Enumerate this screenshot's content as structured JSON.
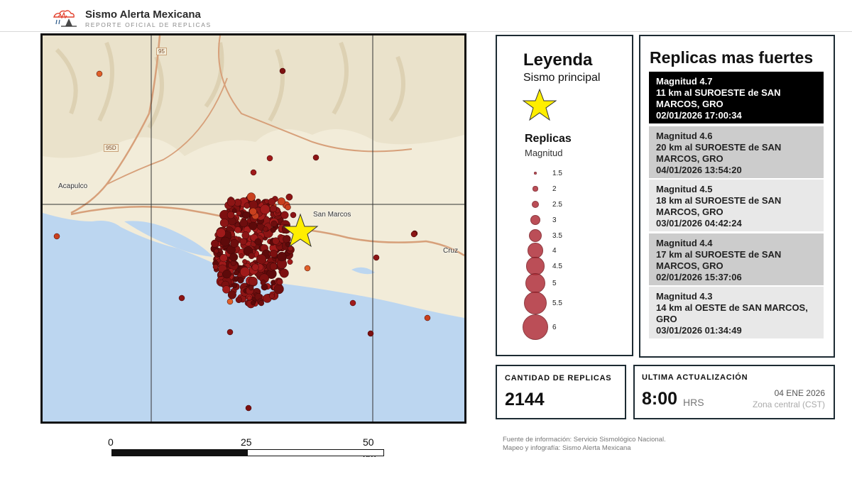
{
  "app": {
    "title": "Sismo Alerta Mexicana",
    "subtitle": "REPORTE OFICIAL DE REPLICAS"
  },
  "map": {
    "places": [
      "Acapulco",
      "San Marcos",
      "Cruz"
    ],
    "roads": [
      "95",
      "95D"
    ],
    "colors": {
      "land": "#f2ecd9",
      "sea": "#bcd6f0",
      "aftershock": "#8a1414",
      "main_shock": "#ffee00"
    }
  },
  "scale_bar": {
    "labels": [
      "0",
      "25",
      "50 km"
    ]
  },
  "legend": {
    "title": "Leyenda",
    "main_shock_label": "Sismo principal",
    "main_shock_icon": "star-icon",
    "aftershocks_label": "Replicas",
    "magnitude_label": "Magnitud",
    "sizes": [
      "1.5",
      "2",
      "2.5",
      "3",
      "3.5",
      "4",
      "4.5",
      "5",
      "5.5",
      "6"
    ]
  },
  "strongest": {
    "title": "Replicas mas fuertes",
    "items": [
      {
        "magnitude": "Magnitud 4.7",
        "location": "11 km al SUROESTE de SAN MARCOS, GRO",
        "datetime": "02/01/2026 17:00:34"
      },
      {
        "magnitude": "Magnitud 4.6",
        "location": "20 km al SUROESTE de SAN MARCOS, GRO",
        "datetime": "04/01/2026 13:54:20"
      },
      {
        "magnitude": "Magnitud 4.5",
        "location": "18 km al SUROESTE de SAN MARCOS, GRO",
        "datetime": "03/01/2026 04:42:24"
      },
      {
        "magnitude": "Magnitud 4.4",
        "location": "17 km al SUROESTE de SAN MARCOS, GRO",
        "datetime": "02/01/2026 15:37:06"
      },
      {
        "magnitude": "Magnitud 4.3",
        "location": "14 km al OESTE de SAN MARCOS, GRO",
        "datetime": "03/01/2026 01:34:49"
      }
    ]
  },
  "count": {
    "label": "CANTIDAD DE REPLICAS",
    "value": "2144"
  },
  "update": {
    "label": "ULTIMA ACTUALIZACIÓN",
    "time": "8:00",
    "unit": "HRS",
    "date": "04 ENE 2026",
    "zone": "Zona central (CST)"
  },
  "source": {
    "line1": "Fuente de información: Servicio Sismológico Nacional.",
    "line2": "Mapeo y infografía: Sismo Alerta Mexicana"
  }
}
